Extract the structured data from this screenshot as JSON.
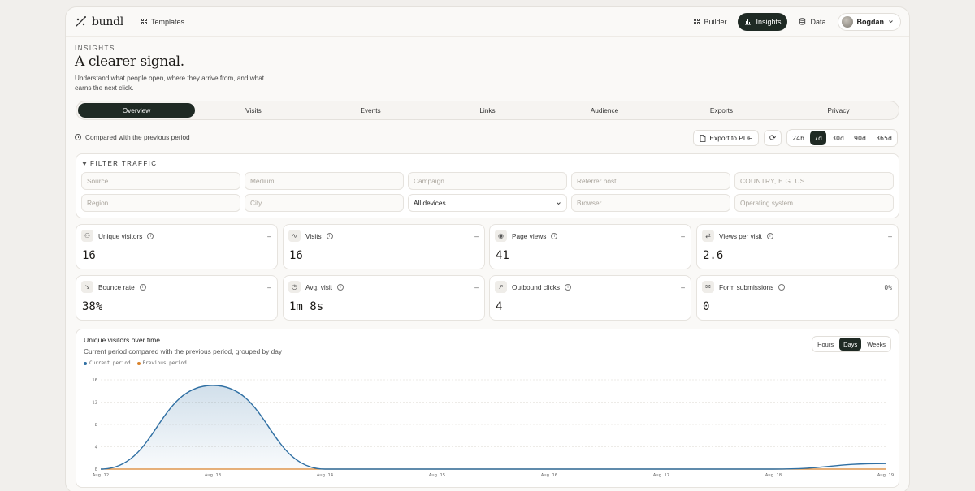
{
  "nav": {
    "brand": "bundl",
    "templates": "Templates",
    "builder": "Builder",
    "insights": "Insights",
    "data": "Data",
    "user": "Bogdan"
  },
  "header": {
    "eyebrow": "INSIGHTS",
    "title": "A clearer signal.",
    "subtitle": "Understand what people open, where they arrive from, and what earns the next click."
  },
  "tabs": [
    "Overview",
    "Visits",
    "Events",
    "Links",
    "Audience",
    "Exports",
    "Privacy"
  ],
  "compare_text": "Compared with the previous period",
  "toolbar": {
    "export": "Export to PDF",
    "ranges": [
      "24h",
      "7d",
      "30d",
      "90d",
      "365d"
    ],
    "active_range": "7d"
  },
  "filters": {
    "title": "FILTER TRAFFIC",
    "row1": [
      "Source",
      "Medium",
      "Campaign",
      "Referrer host",
      "COUNTRY, E.G. US"
    ],
    "row2": [
      "Region",
      "City",
      "All devices",
      "Browser",
      "Operating system"
    ]
  },
  "metrics": [
    {
      "label": "Unique visitors",
      "value": "16",
      "delta": "–",
      "icon": "users-icon"
    },
    {
      "label": "Visits",
      "value": "16",
      "delta": "–",
      "icon": "activity-icon"
    },
    {
      "label": "Page views",
      "value": "41",
      "delta": "–",
      "icon": "eye-icon"
    },
    {
      "label": "Views per visit",
      "value": "2.6",
      "delta": "–",
      "icon": "repeat-icon"
    },
    {
      "label": "Bounce rate",
      "value": "38%",
      "delta": "–",
      "icon": "bounce-icon"
    },
    {
      "label": "Avg. visit",
      "value": "1m 8s",
      "delta": "–",
      "icon": "clock-icon"
    },
    {
      "label": "Outbound clicks",
      "value": "4",
      "delta": "–",
      "icon": "external-link-icon"
    },
    {
      "label": "Form submissions",
      "value": "0",
      "delta": "0%",
      "icon": "mail-icon"
    }
  ],
  "chart": {
    "title": "Unique visitors over time",
    "subtitle": "Current period compared with the previous period, grouped by day",
    "granularity": [
      "Hours",
      "Days",
      "Weeks"
    ],
    "active_granularity": "Days",
    "colors": {
      "current": "#2f6fa3",
      "previous": "#d9822b"
    }
  },
  "chart_data": {
    "type": "area",
    "x": [
      "Aug 12",
      "Aug 13",
      "Aug 14",
      "Aug 15",
      "Aug 16",
      "Aug 17",
      "Aug 18",
      "Aug 19"
    ],
    "ylim": [
      0,
      16
    ],
    "yticks": [
      0,
      4,
      8,
      12,
      16
    ],
    "series": [
      {
        "name": "Current period",
        "values": [
          0,
          15,
          0,
          0,
          0,
          0,
          0,
          1
        ]
      },
      {
        "name": "Previous period",
        "values": [
          0,
          0,
          0,
          0,
          0,
          0,
          0,
          0
        ]
      }
    ],
    "grid": true,
    "legend": "top-left"
  }
}
